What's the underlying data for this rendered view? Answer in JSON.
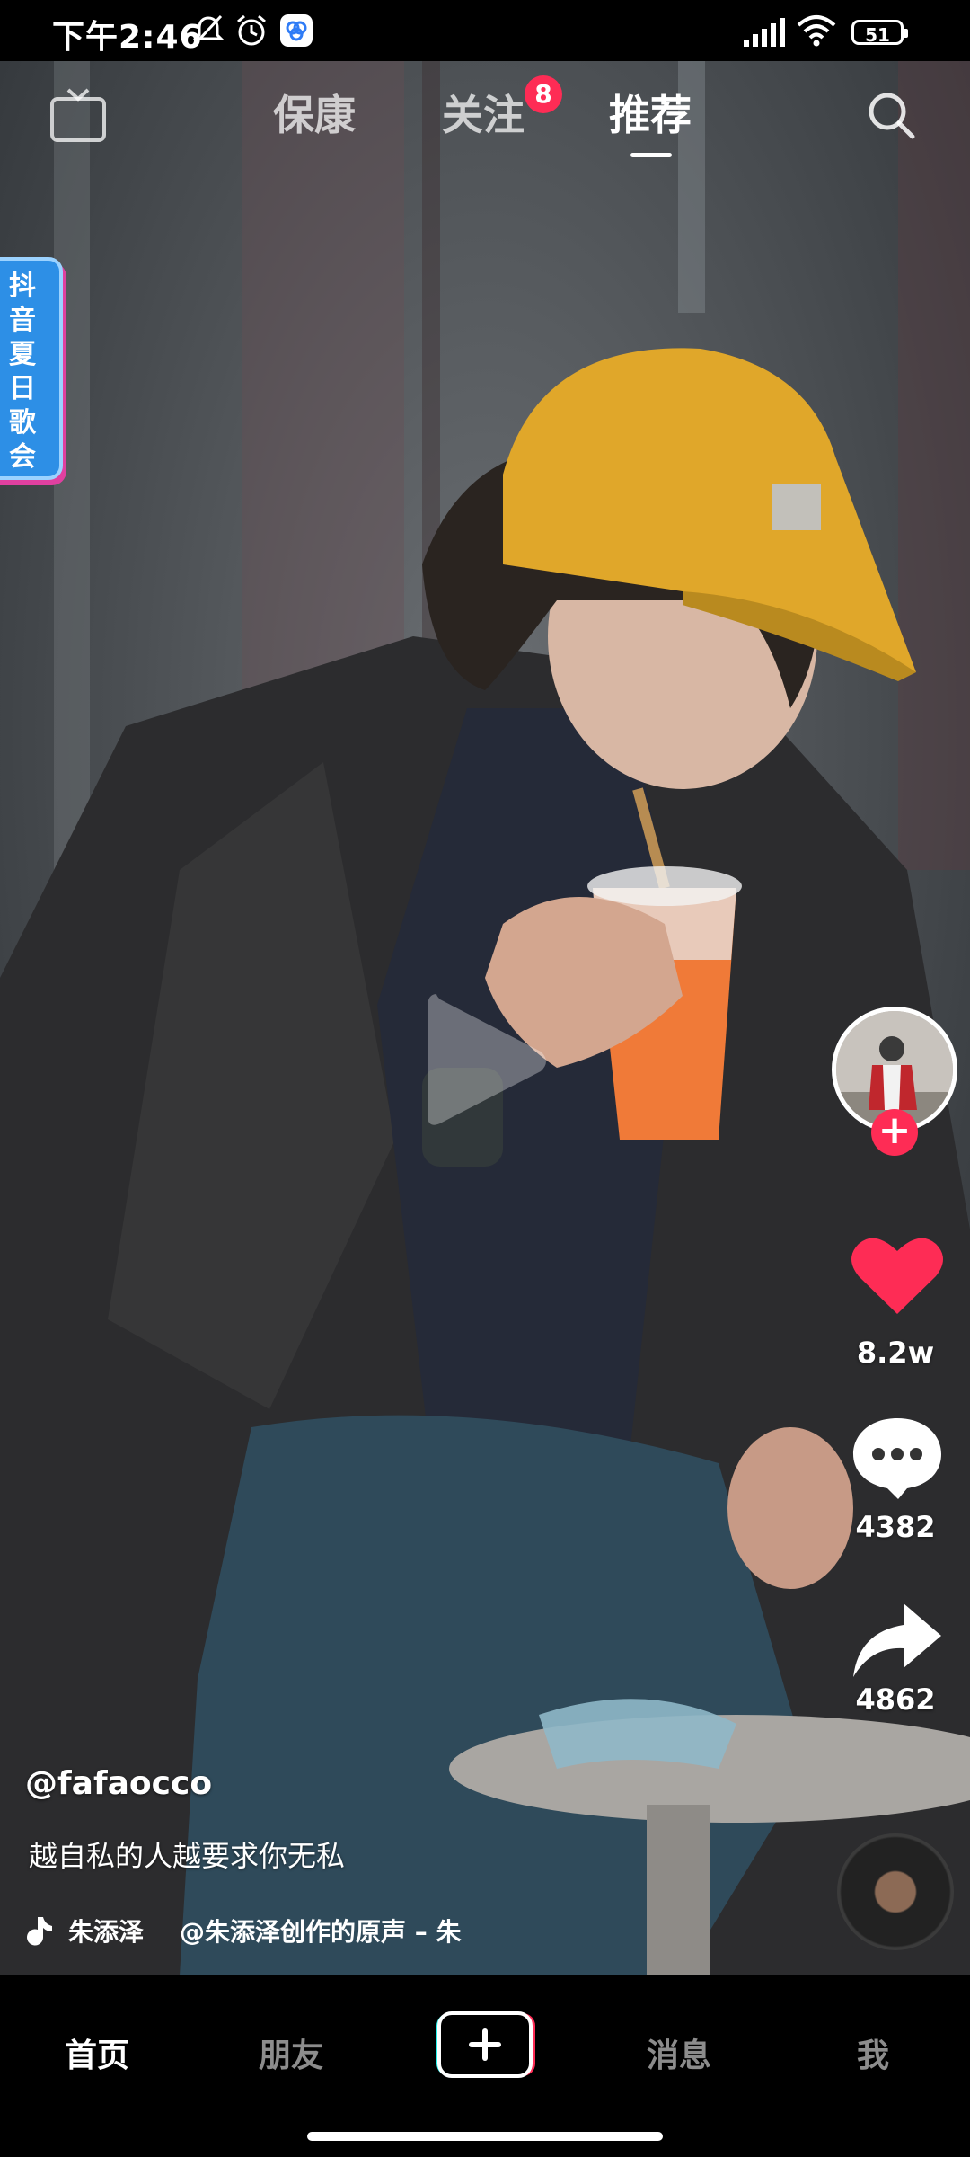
{
  "status_bar": {
    "time": "下午2:46",
    "battery": "51",
    "icons": [
      "mute-bell-icon",
      "alarm-icon",
      "app-notification-icon",
      "signal-icon",
      "wifi-icon",
      "battery-icon"
    ]
  },
  "top_nav": {
    "live_label": "直播",
    "tabs": [
      {
        "label": "保康"
      },
      {
        "label": "关注"
      },
      {
        "label": "推荐"
      }
    ],
    "active_tab": "推荐",
    "follow_badge": "8"
  },
  "side_banner": {
    "label": "抖音夏日歌会"
  },
  "actions": {
    "likes": "8.2w",
    "comments": "4382",
    "shares": "4862"
  },
  "post": {
    "username": "@fafaocco",
    "caption": "越自私的人越要求你无私",
    "music_artist": "朱添泽",
    "music_title": "@朱添泽创作的原声 – 朱"
  },
  "bottom_nav": {
    "items": [
      {
        "label": "首页"
      },
      {
        "label": "朋友"
      },
      {
        "label": "消息"
      },
      {
        "label": "我"
      }
    ],
    "active": "首页"
  },
  "colors": {
    "accent_red": "#fe2c55",
    "cap_yellow": "#e0a72a",
    "drink_orange": "#f07a38"
  }
}
